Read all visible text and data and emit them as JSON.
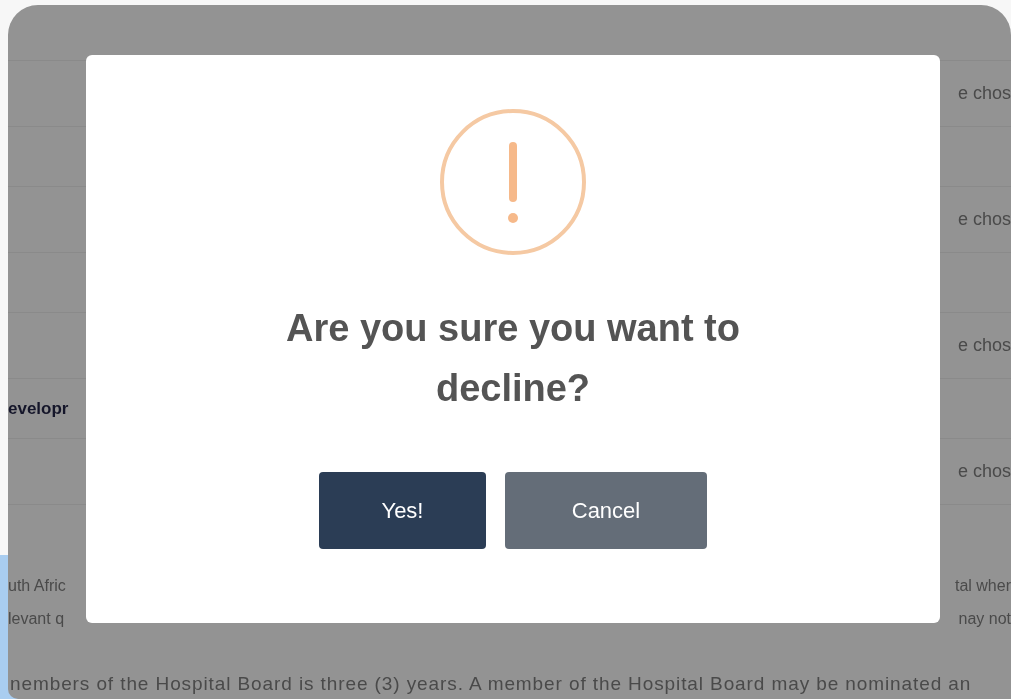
{
  "background": {
    "rows": [
      {
        "right": "e chos"
      },
      {},
      {
        "right": "e chos"
      },
      {},
      {
        "right": "e chos"
      },
      {
        "left": "evelopr"
      },
      {
        "right": "e chos"
      }
    ],
    "paragraph_lines": [
      {
        "left": "uth Afric",
        "right": "tal wher"
      },
      {
        "left": "levant q",
        "right": "nay not"
      }
    ],
    "footer_line": "nembers of the Hospital Board is three (3) years. A member of the Hospital Board may be nominated an"
  },
  "dialog": {
    "title": "Are you sure you want to decline?",
    "buttons": [
      {
        "label": "Yes!",
        "kind": "confirm"
      },
      {
        "label": "Cancel",
        "kind": "cancel"
      }
    ]
  }
}
